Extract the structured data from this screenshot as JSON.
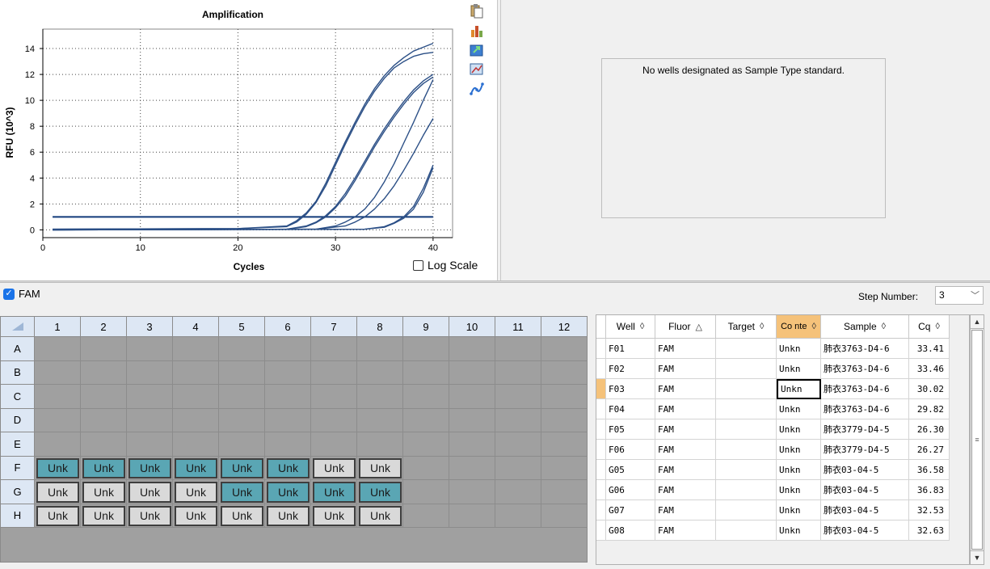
{
  "chart_data": {
    "type": "line",
    "title": "Amplification",
    "xlabel": "Cycles",
    "ylabel": "RFU (10^3)",
    "xlim": [
      0,
      42
    ],
    "ylim": [
      -0.6,
      15.5
    ],
    "xticks": [
      0,
      10,
      20,
      30,
      40
    ],
    "yticks": [
      0,
      2,
      4,
      6,
      8,
      10,
      12,
      14
    ],
    "grid": true,
    "threshold": 1.0,
    "series": [
      {
        "x": [
          1,
          20,
          25,
          26,
          27,
          28,
          29,
          30,
          31,
          32,
          33,
          34,
          35,
          36,
          37,
          38,
          39,
          40
        ],
        "y": [
          0.05,
          0.1,
          0.3,
          0.7,
          1.3,
          2.2,
          3.6,
          5.2,
          6.8,
          8.3,
          9.7,
          10.9,
          11.9,
          12.7,
          13.3,
          13.8,
          14.1,
          14.4
        ]
      },
      {
        "x": [
          1,
          20,
          25,
          26,
          27,
          28,
          29,
          30,
          31,
          32,
          33,
          34,
          35,
          36,
          37,
          38,
          39,
          40
        ],
        "y": [
          0.05,
          0.1,
          0.25,
          0.6,
          1.2,
          2.1,
          3.4,
          5.0,
          6.6,
          8.1,
          9.5,
          10.7,
          11.7,
          12.5,
          13.0,
          13.4,
          13.6,
          13.7
        ]
      },
      {
        "x": [
          1,
          25,
          27,
          28,
          29,
          30,
          31,
          32,
          33,
          34,
          35,
          36,
          37,
          38,
          39,
          40
        ],
        "y": [
          0.0,
          0.05,
          0.3,
          0.6,
          1.1,
          1.8,
          2.8,
          4.0,
          5.3,
          6.6,
          7.8,
          8.9,
          9.9,
          10.8,
          11.5,
          12.0
        ]
      },
      {
        "x": [
          1,
          25,
          27,
          28,
          29,
          30,
          31,
          32,
          33,
          34,
          35,
          36,
          37,
          38,
          39,
          40
        ],
        "y": [
          0.0,
          0.05,
          0.25,
          0.55,
          1.0,
          1.7,
          2.6,
          3.8,
          5.1,
          6.4,
          7.6,
          8.7,
          9.7,
          10.6,
          11.3,
          11.8
        ]
      },
      {
        "x": [
          1,
          28,
          30,
          31,
          32,
          33,
          34,
          35,
          36,
          37,
          38,
          39,
          40
        ],
        "y": [
          0.0,
          0.05,
          0.3,
          0.6,
          1.0,
          1.6,
          2.5,
          3.7,
          5.1,
          6.7,
          8.3,
          10.0,
          11.6
        ]
      },
      {
        "x": [
          1,
          28,
          31,
          32,
          33,
          34,
          35,
          36,
          37,
          38,
          39,
          40
        ],
        "y": [
          0.0,
          0.05,
          0.3,
          0.6,
          1.0,
          1.6,
          2.4,
          3.4,
          4.6,
          5.9,
          7.3,
          8.6
        ]
      },
      {
        "x": [
          1,
          33,
          35,
          36,
          37,
          38,
          39,
          40
        ],
        "y": [
          0.0,
          0.05,
          0.25,
          0.55,
          1.0,
          1.8,
          3.2,
          5.0
        ]
      },
      {
        "x": [
          1,
          33,
          35,
          36,
          37,
          38,
          39,
          40
        ],
        "y": [
          0.0,
          0.05,
          0.2,
          0.5,
          0.9,
          1.6,
          2.9,
          4.8
        ]
      }
    ]
  },
  "chart_controls": {
    "log_scale_label": "Log Scale",
    "log_scale_checked": false
  },
  "toolbar_icons": [
    "copy-icon",
    "export-chart-icon",
    "export-data-icon",
    "zoom-chart-icon",
    "line-style-icon"
  ],
  "standard_curve": {
    "message": "No wells designated as Sample Type standard."
  },
  "fluor": {
    "label": "FAM",
    "checked": true
  },
  "step": {
    "label": "Step Number:",
    "value": "3"
  },
  "plate": {
    "columns": [
      "1",
      "2",
      "3",
      "4",
      "5",
      "6",
      "7",
      "8",
      "9",
      "10",
      "11",
      "12"
    ],
    "rows": [
      "A",
      "B",
      "C",
      "D",
      "E",
      "F",
      "G",
      "H"
    ],
    "wells": [
      {
        "row": "F",
        "col": 1,
        "label": "Unk",
        "selected": true
      },
      {
        "row": "F",
        "col": 2,
        "label": "Unk",
        "selected": true
      },
      {
        "row": "F",
        "col": 3,
        "label": "Unk",
        "selected": true
      },
      {
        "row": "F",
        "col": 4,
        "label": "Unk",
        "selected": true
      },
      {
        "row": "F",
        "col": 5,
        "label": "Unk",
        "selected": true
      },
      {
        "row": "F",
        "col": 6,
        "label": "Unk",
        "selected": true
      },
      {
        "row": "F",
        "col": 7,
        "label": "Unk",
        "selected": false
      },
      {
        "row": "F",
        "col": 8,
        "label": "Unk",
        "selected": false
      },
      {
        "row": "G",
        "col": 1,
        "label": "Unk",
        "selected": false
      },
      {
        "row": "G",
        "col": 2,
        "label": "Unk",
        "selected": false
      },
      {
        "row": "G",
        "col": 3,
        "label": "Unk",
        "selected": false
      },
      {
        "row": "G",
        "col": 4,
        "label": "Unk",
        "selected": false
      },
      {
        "row": "G",
        "col": 5,
        "label": "Unk",
        "selected": true
      },
      {
        "row": "G",
        "col": 6,
        "label": "Unk",
        "selected": true
      },
      {
        "row": "G",
        "col": 7,
        "label": "Unk",
        "selected": true
      },
      {
        "row": "G",
        "col": 8,
        "label": "Unk",
        "selected": true
      },
      {
        "row": "H",
        "col": 1,
        "label": "Unk",
        "selected": false
      },
      {
        "row": "H",
        "col": 2,
        "label": "Unk",
        "selected": false
      },
      {
        "row": "H",
        "col": 3,
        "label": "Unk",
        "selected": false
      },
      {
        "row": "H",
        "col": 4,
        "label": "Unk",
        "selected": false
      },
      {
        "row": "H",
        "col": 5,
        "label": "Unk",
        "selected": false
      },
      {
        "row": "H",
        "col": 6,
        "label": "Unk",
        "selected": false
      },
      {
        "row": "H",
        "col": 7,
        "label": "Unk",
        "selected": false
      },
      {
        "row": "H",
        "col": 8,
        "label": "Unk",
        "selected": false
      }
    ]
  },
  "results": {
    "columns": [
      {
        "label": "Well",
        "sort": "◊"
      },
      {
        "label": "Fluor",
        "sort": "△"
      },
      {
        "label": "Target",
        "sort": "◊"
      },
      {
        "label": "Co nte",
        "sort": "◊"
      },
      {
        "label": "Sample",
        "sort": "◊"
      },
      {
        "label": "Cq",
        "sort": "◊"
      }
    ],
    "rows": [
      [
        "F01",
        "FAM",
        "",
        "Unkn",
        "肺衣3763-D4-6",
        "33.41"
      ],
      [
        "F02",
        "FAM",
        "",
        "Unkn",
        "肺衣3763-D4-6",
        "33.46"
      ],
      [
        "F03",
        "FAM",
        "",
        "Unkn",
        "肺衣3763-D4-6",
        "30.02"
      ],
      [
        "F04",
        "FAM",
        "",
        "Unkn",
        "肺衣3763-D4-6",
        "29.82"
      ],
      [
        "F05",
        "FAM",
        "",
        "Unkn",
        "肺衣3779-D4-5",
        "26.30"
      ],
      [
        "F06",
        "FAM",
        "",
        "Unkn",
        "肺衣3779-D4-5",
        "26.27"
      ],
      [
        "G05",
        "FAM",
        "",
        "Unkn",
        "肺衣03-04-5",
        "36.58"
      ],
      [
        "G06",
        "FAM",
        "",
        "Unkn",
        "肺衣03-04-5",
        "36.83"
      ],
      [
        "G07",
        "FAM",
        "",
        "Unkn",
        "肺衣03-04-5",
        "32.53"
      ],
      [
        "G08",
        "FAM",
        "",
        "Unkn",
        "肺衣03-04-5",
        "32.63"
      ]
    ],
    "current_row": 2,
    "current_col": 3
  },
  "colors": {
    "curve": "#2b4f86",
    "threshold": "#123a7a",
    "well_selected": "#5aa6b4",
    "well_default": "#d9d9d9",
    "header_active": "#f5c27a"
  }
}
